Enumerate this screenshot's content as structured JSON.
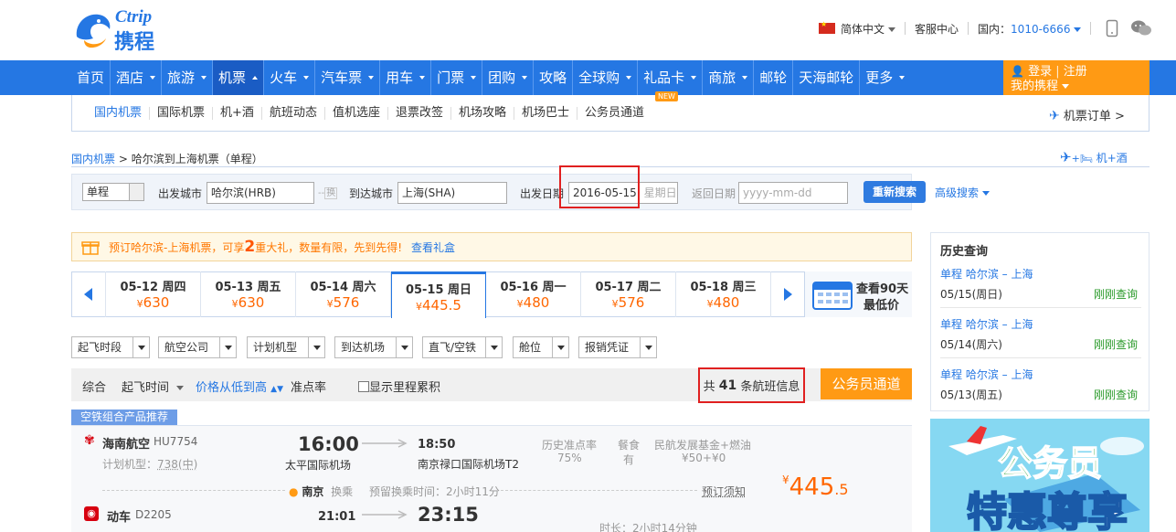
{
  "logo": {
    "brand_en": "Ctrip",
    "brand_cn": "携程"
  },
  "topbar": {
    "language": "简体中文",
    "service": "客服中心",
    "phone_label": "国内：",
    "phone": "1010-6666"
  },
  "nav": {
    "items": [
      "首页",
      "酒店",
      "旅游",
      "机票",
      "火车",
      "汽车票",
      "用车",
      "门票",
      "团购",
      "攻略",
      "全球购",
      "礼品卡",
      "商旅",
      "邮轮",
      "天海邮轮",
      "更多"
    ],
    "active": "机票"
  },
  "account": {
    "login": "登录",
    "register": "注册",
    "my_trip": "我的携程"
  },
  "subnav": {
    "items": [
      "国内机票",
      "国际机票",
      "机+酒",
      "航班动态",
      "值机选座",
      "退票改签",
      "机场攻略",
      "机场巴士",
      "公务员通道"
    ],
    "new_badge": "NEW",
    "orders": "机票订单 >"
  },
  "breadcrumb": {
    "root": "国内机票",
    "sep": ">",
    "current": "哈尔滨到上海机票（单程）"
  },
  "flight_hotel_link": "机+酒",
  "search": {
    "trip_type": "单程",
    "depart_city_label": "出发城市",
    "depart_city": "哈尔滨(HRB)",
    "swap": "换",
    "arrive_city_label": "到达城市",
    "arrive_city": "上海(SHA)",
    "depart_date_label": "出发日期",
    "depart_date": "2016-05-15",
    "depart_weekday": "星期日",
    "return_date_label": "返回日期",
    "return_placeholder": "yyyy-mm-dd",
    "search_button": "重新搜索",
    "advanced": "高级搜索"
  },
  "promo": {
    "text_before": "预订哈尔滨-上海机票，可享",
    "number": "2",
    "text_after": "重大礼，数量有限，先到先得!",
    "link": "查看礼盒"
  },
  "date_tabs": [
    {
      "date": "05-12 周四",
      "price": "630"
    },
    {
      "date": "05-13 周五",
      "price": "630"
    },
    {
      "date": "05-14 周六",
      "price": "576"
    },
    {
      "date": "05-15 周日",
      "price": "445.5"
    },
    {
      "date": "05-16 周一",
      "price": "480"
    },
    {
      "date": "05-17 周二",
      "price": "576"
    },
    {
      "date": "05-18 周三",
      "price": "480"
    }
  ],
  "lowest_90": {
    "line1": "查看90天",
    "line2": "最低价"
  },
  "currency": "¥",
  "filters": [
    "起飞时段",
    "航空公司",
    "计划机型",
    "到达机场",
    "直飞/空铁",
    "舱位",
    "报销凭证"
  ],
  "sort": {
    "items": [
      "综合",
      "起飞时间",
      "价格从低到高",
      "准点率"
    ],
    "mileage": "显示里程累积",
    "count_prefix": "共",
    "count": "41",
    "count_suffix": "条航班信息",
    "civil_button": "公务员通道"
  },
  "flight": {
    "tag": "空铁组合产品推荐",
    "airline": "海南航空",
    "flight_no": "HU7754",
    "aircraft_label": "计划机型：",
    "aircraft": "738(中)",
    "depart_time": "16:00",
    "depart_airport": "太平国际机场",
    "arrive_time": "18:50",
    "arrive_airport": "南京禄口国际机场T2",
    "ontime_label": "历史准点率",
    "ontime": "75%",
    "meal_label": "餐食",
    "meal": "有",
    "tax_label": "民航发展基金+燃油",
    "tax": "¥50+¥0",
    "transfer_city": "南京",
    "transfer_label": "换乘",
    "transfer_time": "预留换乘时间：2小时11分",
    "booking_note": "预订须知",
    "price_int": "445",
    "price_dec": ".5",
    "train_label": "动车",
    "train_no": "D2205",
    "train_depart": "21:01",
    "train_arrive": "23:15",
    "duration": "时长：2小时14分钟"
  },
  "history": {
    "title": "历史查询",
    "items": [
      {
        "route": "单程 哈尔滨 – 上海",
        "date": "05/15(周日)",
        "status": "刚刚查询"
      },
      {
        "route": "单程 哈尔滨 – 上海",
        "date": "05/14(周六)",
        "status": "刚刚查询"
      },
      {
        "route": "单程 哈尔滨 – 上海",
        "date": "05/13(周五)",
        "status": "刚刚查询"
      }
    ]
  },
  "banner": {
    "line1": "公务员",
    "line2": "特惠尊享"
  }
}
